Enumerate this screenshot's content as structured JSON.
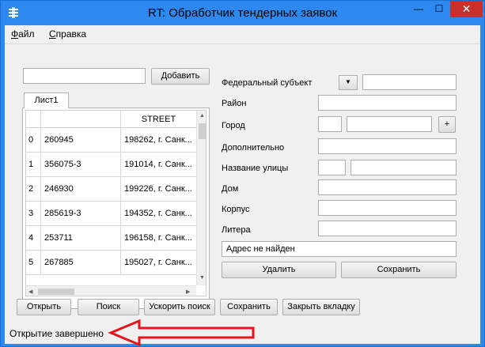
{
  "window": {
    "title": "RT: Обработчик тендерных заявок",
    "minimize": "—",
    "maximize": "☐",
    "close": "✕"
  },
  "menu": {
    "file": "Файл",
    "file_hotkey": "Ф",
    "file_rest": "айл",
    "help": "Справка",
    "help_hotkey": "С",
    "help_rest": "правка"
  },
  "left": {
    "add_input_value": "",
    "add_button": "Добавить",
    "tab_label": "Лист1",
    "table": {
      "columns": [
        "",
        "",
        "STREET"
      ],
      "rows": [
        {
          "idx": "0",
          "id": "260945",
          "street": "198262, г. Санк..."
        },
        {
          "idx": "1",
          "id": "356075-3",
          "street": "191014, г. Санк..."
        },
        {
          "idx": "2",
          "id": "246930",
          "street": "199226, г. Санк..."
        },
        {
          "idx": "3",
          "id": "285619-3",
          "street": "194352, г. Санк..."
        },
        {
          "idx": "4",
          "id": "253711",
          "street": "196158, г. Санк..."
        },
        {
          "idx": "5",
          "id": "267885",
          "street": "195027, г. Санк..."
        }
      ]
    }
  },
  "right": {
    "federal_subject_label": "Федеральный субъект",
    "federal_subject_value": "",
    "federal_subject_extra": "",
    "district_label": "Район",
    "district_value": "",
    "city_label": "Город",
    "city_code": "",
    "city_value": "",
    "city_add_button": "+",
    "additional_label": "Дополнительно",
    "additional_value": "",
    "street_label": "Название улицы",
    "street_type": "",
    "street_value": "",
    "house_label": "Дом",
    "house_value": "",
    "building_label": "Корпус",
    "building_value": "",
    "letter_label": "Литера",
    "letter_value": "",
    "address_status": "Адрес не найден",
    "delete_button": "Удалить",
    "save_button": "Сохранить"
  },
  "bottom": {
    "open_button": "Открыть",
    "search_button": "Поиск",
    "fast_search_button": "Ускорить поиск",
    "save_button": "Сохранить",
    "close_tab_button": "Закрыть вкладку"
  },
  "status": {
    "text": "Открытие завершено"
  },
  "colors": {
    "titlebar": "#2d89ef",
    "close": "#c7302b",
    "annotation_arrow": "#e8141c"
  }
}
